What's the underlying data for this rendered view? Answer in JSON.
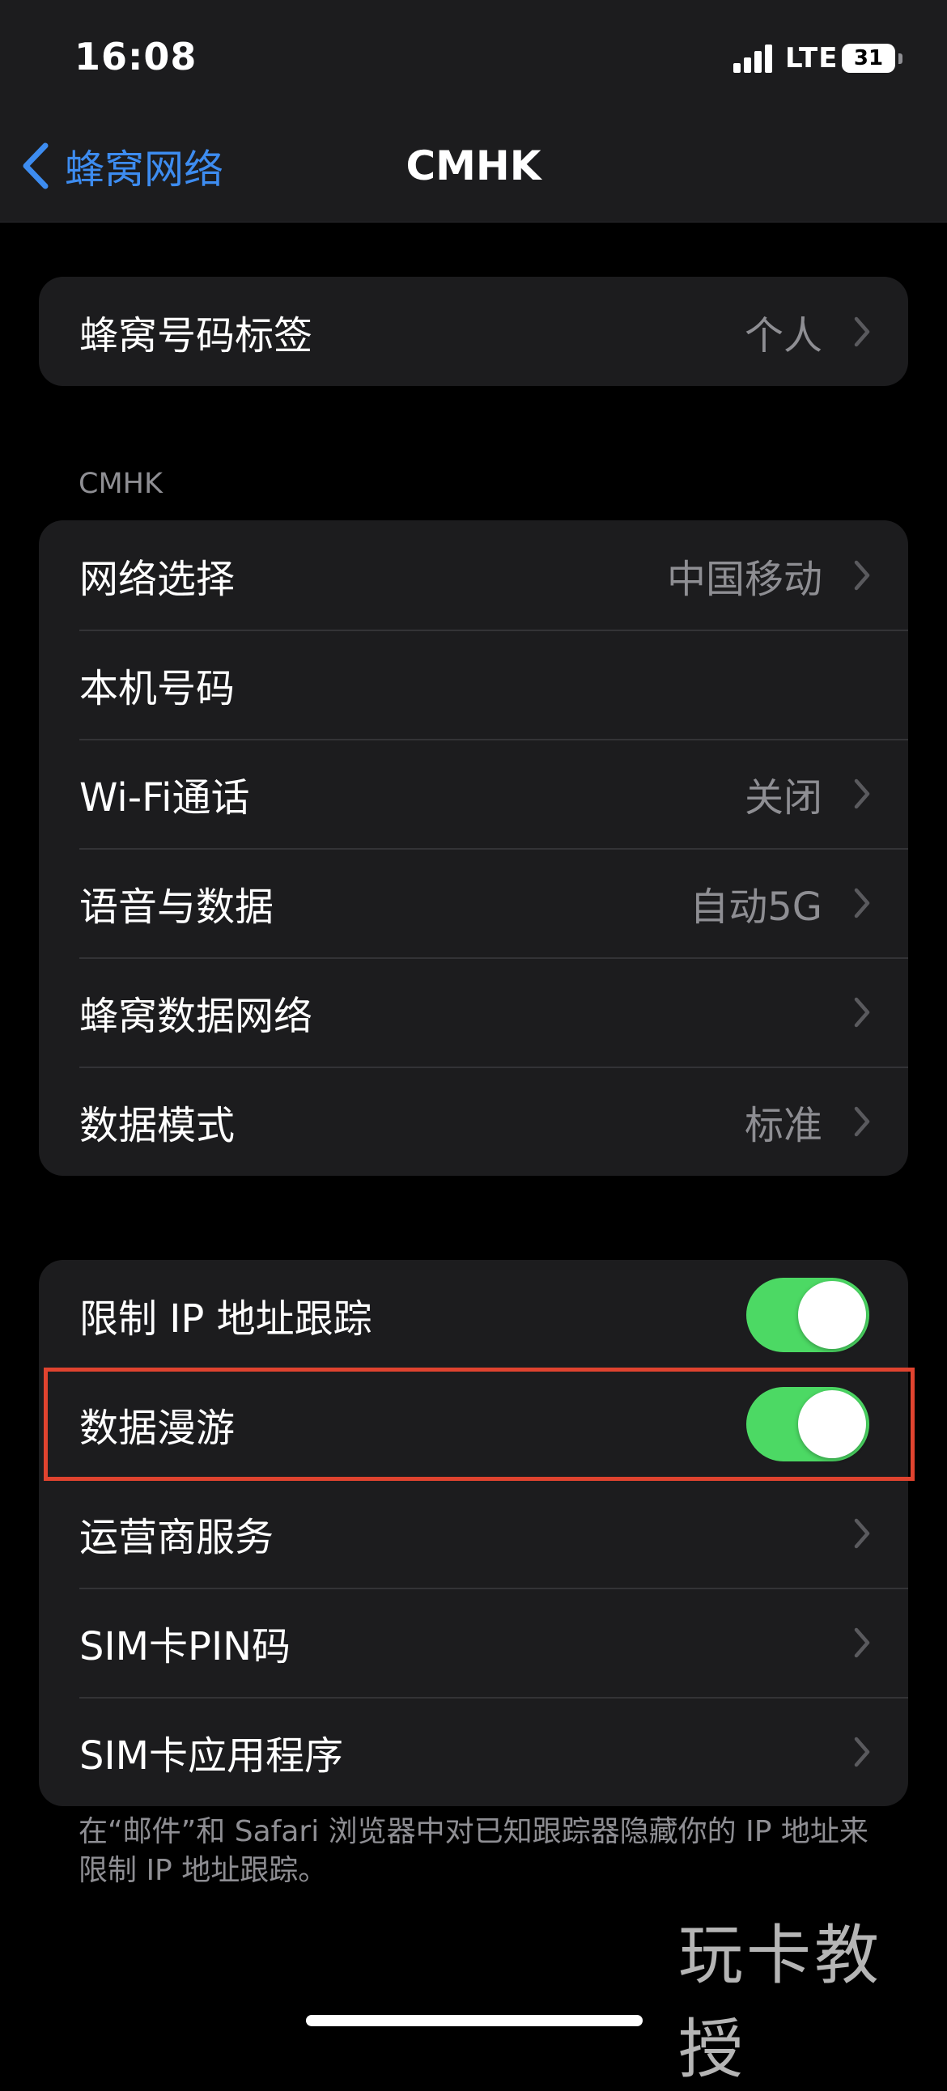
{
  "status_bar": {
    "time": "16:08",
    "network": "LTE",
    "battery": "31"
  },
  "nav": {
    "back_label": "蜂窝网络",
    "title": "CMHK"
  },
  "group1": {
    "rows": [
      {
        "label": "蜂窝号码标签",
        "value": "个人"
      }
    ]
  },
  "section_header": "CMHK",
  "group2": {
    "rows": [
      {
        "label": "网络选择",
        "value": "中国移动"
      },
      {
        "label": "本机号码",
        "value": ""
      },
      {
        "label": "Wi-Fi通话",
        "value": "关闭"
      },
      {
        "label": "语音与数据",
        "value": "自动5G"
      },
      {
        "label": "蜂窝数据网络",
        "value": ""
      },
      {
        "label": "数据模式",
        "value": "标准"
      }
    ]
  },
  "group3": {
    "rows": [
      {
        "label": "限制 IP 地址跟踪",
        "toggle": true
      },
      {
        "label": "数据漫游",
        "toggle": true
      },
      {
        "label": "运营商服务"
      },
      {
        "label": "SIM卡PIN码"
      },
      {
        "label": "SIM卡应用程序"
      }
    ]
  },
  "footer_note": "在“邮件”和 Safari 浏览器中对已知跟踪器隐藏你的 IP 地址来限制 IP 地址跟踪。",
  "watermark": "玩卡教授",
  "colors": {
    "accent": "#3d8cf0",
    "toggle_on": "#4cd964",
    "highlight": "#e0432f",
    "group_bg": "#1c1c1e",
    "secondary_text": "#8e8e93"
  }
}
